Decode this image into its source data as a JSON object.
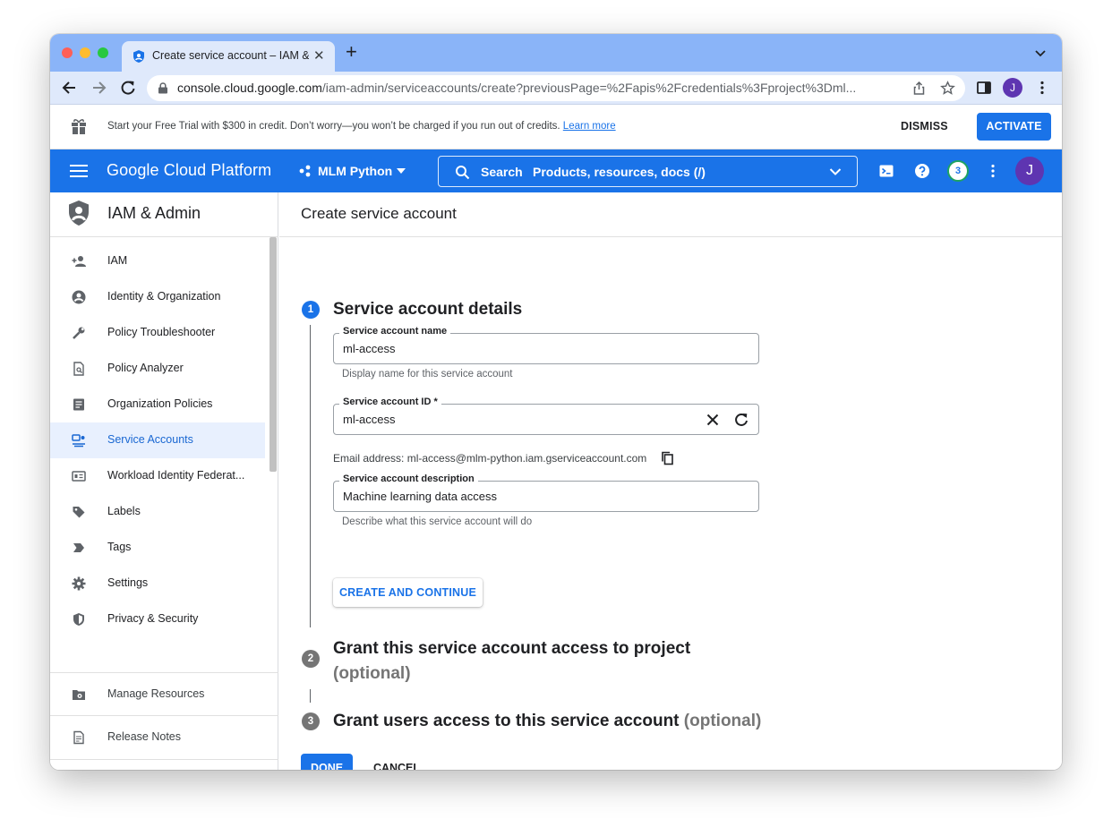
{
  "browser": {
    "tab_title": "Create service account – IAM & Admin",
    "url_host": "console.cloud.google.com",
    "url_path": "/iam-admin/serviceaccounts/create?previousPage=%2Fapis%2Fcredentials%3Fproject%3Dml...",
    "profile_initial": "J"
  },
  "banner": {
    "text": "Start your Free Trial with $300 in credit. Don’t worry—you won’t be charged if you run out of credits.",
    "link": "Learn more",
    "dismiss": "DISMISS",
    "activate": "ACTIVATE"
  },
  "header": {
    "product": "Google Cloud Platform",
    "project": "MLM Python",
    "search_label": "Search",
    "search_placeholder": "Products, resources, docs (/)",
    "notification_count": "3",
    "avatar_initial": "J",
    "brand_color": "#1a73e8"
  },
  "sidebar": {
    "title": "IAM & Admin",
    "items": [
      {
        "label": "IAM",
        "icon": "person-add-icon"
      },
      {
        "label": "Identity & Organization",
        "icon": "account-circle-icon"
      },
      {
        "label": "Policy Troubleshooter",
        "icon": "wrench-icon"
      },
      {
        "label": "Policy Analyzer",
        "icon": "document-search-icon"
      },
      {
        "label": "Organization Policies",
        "icon": "list-document-icon"
      },
      {
        "label": "Service Accounts",
        "icon": "service-account-icon",
        "active": true
      },
      {
        "label": "Workload Identity Federat...",
        "icon": "id-card-icon"
      },
      {
        "label": "Labels",
        "icon": "label-icon"
      },
      {
        "label": "Tags",
        "icon": "tag-icon"
      },
      {
        "label": "Settings",
        "icon": "gear-icon"
      },
      {
        "label": "Privacy & Security",
        "icon": "shield-icon"
      }
    ],
    "footer_items": [
      {
        "label": "Manage Resources",
        "icon": "folder-gear-icon"
      },
      {
        "label": "Release Notes",
        "icon": "release-notes-icon"
      }
    ],
    "collapse": "<I"
  },
  "main": {
    "page_title": "Create service account",
    "step1": {
      "number": "1",
      "title": "Service account details",
      "name_label": "Service account name",
      "name_value": "ml-access",
      "name_hint": "Display name for this service account",
      "id_label": "Service account ID *",
      "id_value": "ml-access",
      "email_line": "Email address: ml-access@mlm-python.iam.gserviceaccount.com",
      "desc_label": "Service account description",
      "desc_value": "Machine learning data access",
      "desc_hint": "Describe what this service account will do",
      "create_button": "CREATE AND CONTINUE"
    },
    "step2": {
      "number": "2",
      "title": "Grant this service account access to project",
      "optional": "(optional)"
    },
    "step3": {
      "number": "3",
      "title": "Grant users access to this service account",
      "optional": "(optional)"
    },
    "done_button": "DONE",
    "cancel_button": "CANCEL"
  }
}
